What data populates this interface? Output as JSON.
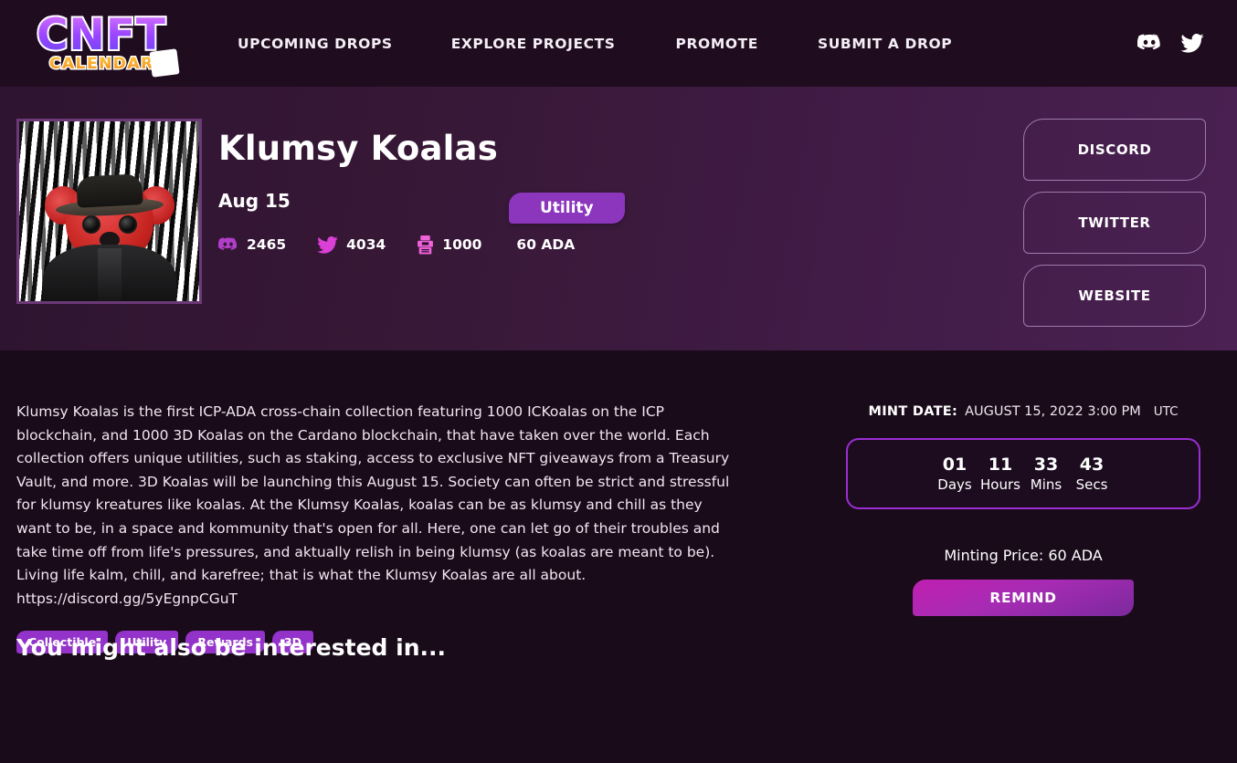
{
  "header": {
    "logo": {
      "primary": "CNFT",
      "secondary": "CALENDAR",
      "icon": "calendar-icon"
    },
    "nav": [
      {
        "label": "UPCOMING DROPS"
      },
      {
        "label": "EXPLORE PROJECTS"
      },
      {
        "label": "PROMOTE"
      },
      {
        "label": "SUBMIT A DROP"
      }
    ],
    "socials": [
      {
        "name": "discord-icon"
      },
      {
        "name": "twitter-icon"
      }
    ]
  },
  "hero": {
    "thumbnail_alt": "Klumsy Koala red bear with black hat and leather jacket",
    "title": "Klumsy Koalas",
    "date": "Aug 15",
    "badge": "Utility",
    "stats": [
      {
        "icon": "discord-icon",
        "value": "2465"
      },
      {
        "icon": "twitter-icon",
        "value": "4034"
      },
      {
        "icon": "mint-machine-icon",
        "value": "1000"
      },
      {
        "icon": "none",
        "value": "60 ADA"
      }
    ],
    "buttons": [
      {
        "label": "DISCORD"
      },
      {
        "label": "TWITTER"
      },
      {
        "label": "WEBSITE"
      }
    ]
  },
  "main": {
    "description": "Klumsy Koalas is the first ICP-ADA cross-chain collection featuring 1000 ICKoalas on the ICP blockchain, and 1000 3D Koalas on the Cardano blockchain, that have taken over the world. Each collection offers unique utilities, such as staking, access to exclusive NFT giveaways from a Treasury Vault, and more. 3D Koalas will be launching this August 15. Society can often be strict and stressful for klumsy kreatures like koalas. At the Klumsy Koalas, koalas can be as klumsy and chill as they want to be, in a space and kommunity that's open for all. Here, one can let go of their troubles and take time off from life's pressures, and aktually relish in being klumsy (as koalas are meant to be). Living life kalm, chill, and karefree; that is what the Klumsy Koalas are all about. https://discord.gg/5yEgnpCGuT",
    "tags": [
      {
        "label": "Collectible"
      },
      {
        "label": "Utility"
      },
      {
        "label": "Rewards"
      },
      {
        "label": "3D"
      }
    ],
    "mint": {
      "label": "MINT DATE:",
      "value": "AUGUST 15, 2022 3:00 PM",
      "timezone": "UTC",
      "countdown": [
        {
          "value": "01",
          "unit": "Days"
        },
        {
          "value": "11",
          "unit": "Hours"
        },
        {
          "value": "33",
          "unit": "Mins"
        },
        {
          "value": "43",
          "unit": "Secs"
        }
      ],
      "price": "Minting Price: 60 ADA",
      "remind_label": "REMIND"
    }
  },
  "also": {
    "title": "You might also be interested in..."
  },
  "colors": {
    "header_bg": "#1f0c1e",
    "page_bg": "#190b1a",
    "hero_left": "#2e1430",
    "hero_right": "#4a2152",
    "accent_purple": "#8b36bd",
    "tag_purple": "#9333c9",
    "countdown_border": "#9b2ed2",
    "remind_gradient_from": "#c11fb0",
    "remind_gradient_to": "#7b2a9d",
    "stat_icon": "#e255d8"
  }
}
